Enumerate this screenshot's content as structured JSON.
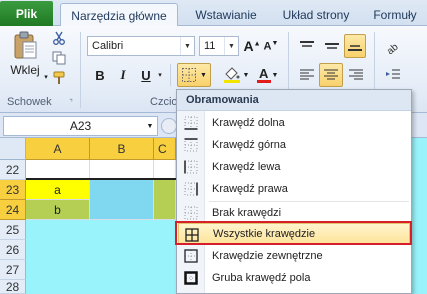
{
  "tabs": {
    "file": "Plik",
    "items": [
      "Narzędzia główne",
      "Wstawianie",
      "Układ strony",
      "Formuły"
    ],
    "active_index": 0
  },
  "clipboard": {
    "paste_label": "Wklej",
    "group_label": "Schowek"
  },
  "font": {
    "name": "Calibri",
    "size": "11",
    "bold": "B",
    "italic": "I",
    "underline": "U",
    "group_label_partial": "Czcio"
  },
  "namebox": {
    "value": "A23"
  },
  "grid": {
    "columns": [
      "A",
      "B",
      "C"
    ],
    "rows": [
      {
        "num": "22",
        "cells": [
          "",
          "",
          ""
        ]
      },
      {
        "num": "23",
        "cells": [
          "a",
          "",
          ""
        ]
      },
      {
        "num": "24",
        "cells": [
          "b",
          "",
          ""
        ]
      },
      {
        "num": "25",
        "cells": [
          "",
          "",
          ""
        ]
      },
      {
        "num": "26",
        "cells": [
          "",
          "",
          ""
        ]
      },
      {
        "num": "27",
        "cells": [
          "",
          "",
          ""
        ]
      },
      {
        "num": "28",
        "cells": [
          "",
          "",
          ""
        ]
      }
    ]
  },
  "borders_menu": {
    "title": "Obramowania",
    "items": [
      {
        "label": "Krawędź dolna",
        "icon": "border-bottom-icon"
      },
      {
        "label": "Krawędź górna",
        "icon": "border-top-icon"
      },
      {
        "label": "Krawędź lewa",
        "icon": "border-left-icon"
      },
      {
        "label": "Krawędź prawa",
        "icon": "border-right-icon"
      },
      {
        "label": "Brak krawędzi",
        "icon": "no-border-icon"
      },
      {
        "label": "Wszystkie krawędzie",
        "icon": "all-borders-icon",
        "highlighted": true
      },
      {
        "label": "Krawędzie zewnętrzne",
        "icon": "outside-borders-icon"
      },
      {
        "label": "Gruba krawędź pola",
        "icon": "thick-box-border-icon"
      }
    ]
  },
  "colors": {
    "file_tab": "#2a8a2e",
    "header_highlight": "#f8cf3f",
    "cell_yellow": "#ffff00",
    "cell_green_a": "#b5cf55",
    "cell_cyan": "#7fd8f0",
    "fill_cyan": "#99f3fb",
    "menu_highlight_border": "#d71f2c",
    "font_color_red": "#e21b1b"
  }
}
